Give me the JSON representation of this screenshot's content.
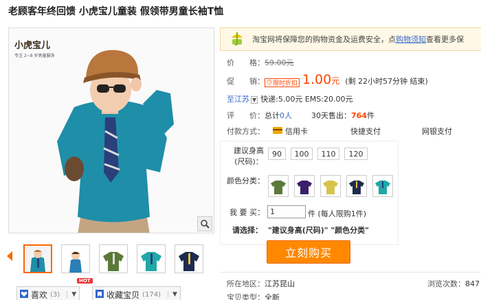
{
  "title": "老顾客年终回馈 小虎宝儿童装 假领带男童长袖T恤",
  "logo": {
    "brand": "小虎宝儿",
    "sub": "专注 2~8 岁男童服饰"
  },
  "notice": {
    "prefix": "淘宝网将保障您的购物资金及运费安全，点",
    "link": "购物须知",
    "suffix": "查看更多保"
  },
  "price": {
    "label": "价　　格：",
    "value": "59.00元"
  },
  "promo": {
    "label": "促　　销：",
    "badge": "限时折扣",
    "price": "1.00",
    "unit": "元",
    "remain": "(剩 22小时57分钟 结束)"
  },
  "shipping": {
    "to": "至江苏",
    "express": "快递:5.00元 EMS:20.00元"
  },
  "review": {
    "label": "评　　价：",
    "total_label": "总计",
    "total_value": "0人",
    "sold_label": "30天售出：",
    "sold_value": "764",
    "sold_unit": "件"
  },
  "payment": {
    "label": "付款方式：",
    "credit": "信用卡",
    "express_pay": "快捷支付",
    "bank": "网银支付"
  },
  "sku": {
    "size_label_1": "建议身高",
    "size_label_2": "(尺码)：",
    "sizes": [
      "90",
      "100",
      "110",
      "120"
    ],
    "color_label": "颜色分类：",
    "qty_label": "我 要 买：",
    "qty_value": "1",
    "qty_note": "件 (每人限购1件)",
    "choose_label": "请选择：",
    "choose_value": "\"建议身高(尺码)\" \"颜色分类\""
  },
  "buy_label": "立刻购买",
  "actions": {
    "like": "喜欢",
    "like_count": "(3)",
    "fav": "收藏宝贝",
    "fav_count": "(174)",
    "hot": "HOT"
  },
  "location": {
    "label": "所在地区：",
    "value": "江苏昆山"
  },
  "item_type": {
    "label": "宝贝类型：",
    "value": "全新"
  },
  "views": {
    "label": "浏览次数：",
    "value": "847"
  },
  "colors": {
    "accent": "#ff4400",
    "buy": "#ff8800",
    "link": "#3366cc"
  }
}
